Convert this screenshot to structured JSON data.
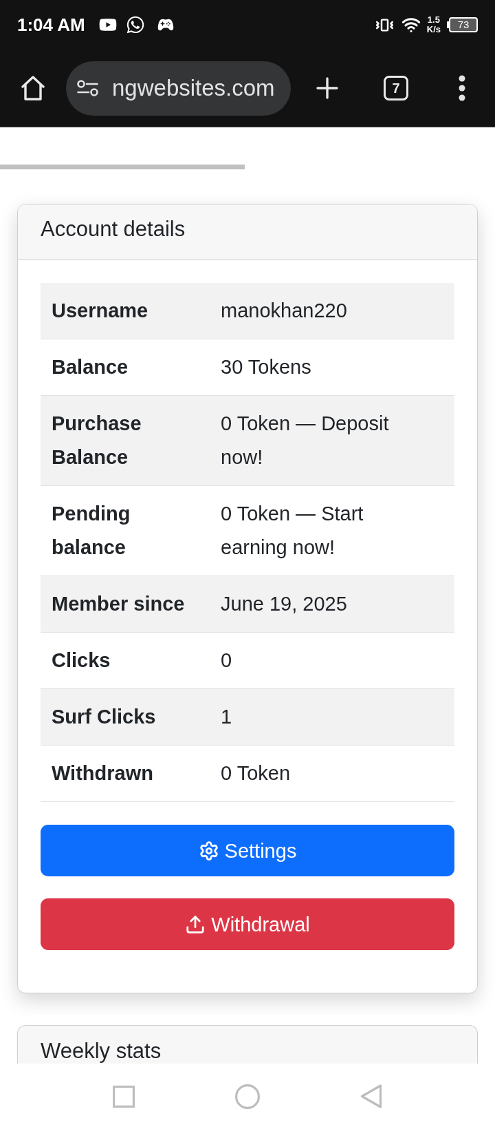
{
  "status_bar": {
    "time": "1:04 AM",
    "network_speed": {
      "value": "1.5",
      "unit": "K/s"
    },
    "battery": "73"
  },
  "browser_toolbar": {
    "url": "ngwebsites.com",
    "tab_count": "7"
  },
  "account_card": {
    "title": "Account details",
    "rows": [
      {
        "label": "Username",
        "value": "manokhan220"
      },
      {
        "label": "Balance",
        "value": "30 Tokens"
      },
      {
        "label": "Purchase Balance",
        "value": "0 Token — Deposit now!"
      },
      {
        "label": "Pending balance",
        "value": "0 Token — Start earning now!"
      },
      {
        "label": "Member since",
        "value": "June 19, 2025"
      },
      {
        "label": "Clicks",
        "value": "0"
      },
      {
        "label": "Surf Clicks",
        "value": "1"
      },
      {
        "label": "Withdrawn",
        "value": "0 Token"
      }
    ],
    "buttons": [
      {
        "kind": "settings",
        "label": "Settings"
      },
      {
        "kind": "withdrawal",
        "label": "Withdrawal"
      }
    ]
  },
  "weekly_stats_card": {
    "title": "Weekly stats"
  }
}
